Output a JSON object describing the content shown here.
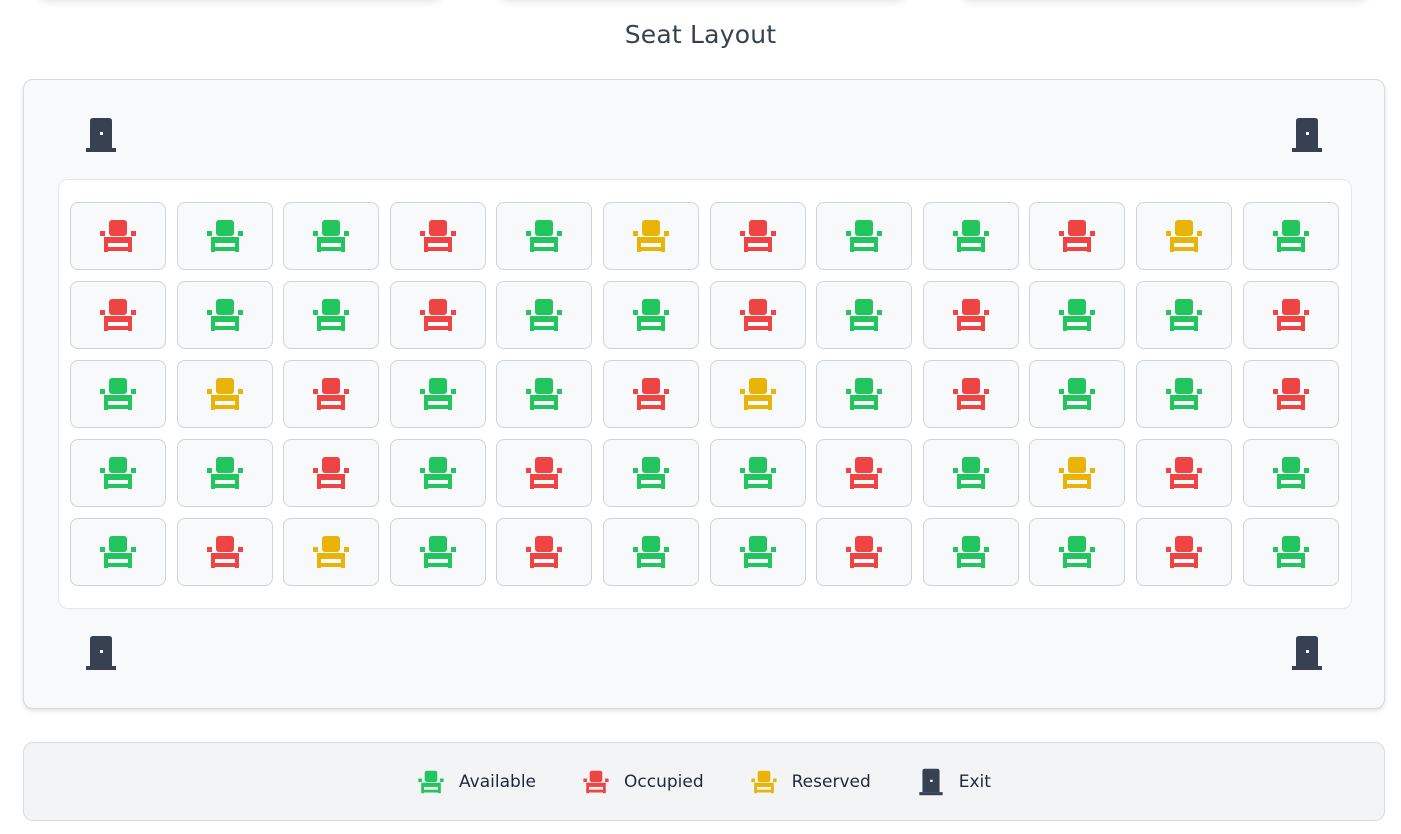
{
  "page": {
    "title": "Seat Layout"
  },
  "colors": {
    "available": "#22c55e",
    "occupied": "#ef4444",
    "reserved": "#eab308",
    "exit": "#374151"
  },
  "icons": {
    "seat": "armchair-icon",
    "exit": "door-icon"
  },
  "seat_rows": [
    [
      "occupied",
      "available",
      "available",
      "occupied",
      "available",
      "reserved",
      "occupied",
      "available",
      "available",
      "occupied",
      "reserved",
      "available"
    ],
    [
      "occupied",
      "available",
      "available",
      "occupied",
      "available",
      "available",
      "occupied",
      "available",
      "occupied",
      "available",
      "available",
      "occupied"
    ],
    [
      "available",
      "reserved",
      "occupied",
      "available",
      "available",
      "occupied",
      "reserved",
      "available",
      "occupied",
      "available",
      "available",
      "occupied"
    ],
    [
      "available",
      "available",
      "occupied",
      "available",
      "occupied",
      "available",
      "available",
      "occupied",
      "available",
      "reserved",
      "occupied",
      "available"
    ],
    [
      "available",
      "occupied",
      "reserved",
      "available",
      "occupied",
      "available",
      "available",
      "occupied",
      "available",
      "available",
      "occupied",
      "available"
    ]
  ],
  "legend": {
    "available": "Available",
    "occupied": "Occupied",
    "reserved": "Reserved",
    "exit": "Exit"
  }
}
